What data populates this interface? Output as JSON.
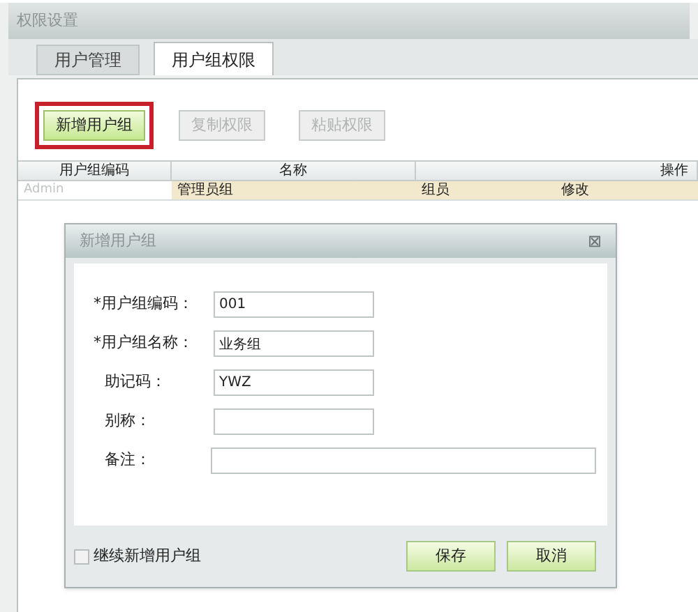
{
  "window": {
    "title": "权限设置"
  },
  "tabs": [
    {
      "label": "用户管理",
      "selected": false
    },
    {
      "label": "用户组权限",
      "selected": true
    }
  ],
  "toolbar": [
    {
      "label": "新增用户组",
      "disabled": false,
      "highlighted": true
    },
    {
      "label": "复制权限",
      "disabled": true,
      "highlighted": false
    },
    {
      "label": "粘贴权限",
      "disabled": true,
      "highlighted": false
    }
  ],
  "table": {
    "columns": [
      "用户组编码",
      "名称",
      "操作"
    ],
    "rows": [
      {
        "code": "Admin",
        "name": "管理员组",
        "actions": [
          "组员",
          "修改"
        ]
      }
    ]
  },
  "dialog": {
    "title": "新增用户组",
    "close": "⊠",
    "fields": [
      {
        "label": "*用户组编码：",
        "value": "001",
        "wide": false
      },
      {
        "label": "*用户组名称：",
        "value": "业务组",
        "wide": false
      },
      {
        "label": "助记码：",
        "value": "YWZ",
        "wide": false
      },
      {
        "label": "别称：",
        "wide": false
      },
      {
        "label": "备注：",
        "wide": true
      }
    ],
    "continue_checkbox": {
      "label": "继续新增用户组",
      "checked": false
    },
    "buttons": [
      "保存",
      "取消"
    ]
  }
}
